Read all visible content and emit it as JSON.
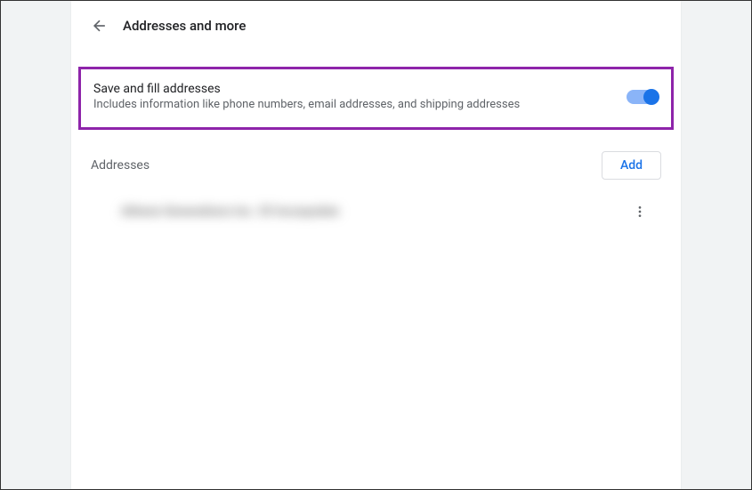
{
  "header": {
    "title": "Addresses and more"
  },
  "setting": {
    "title": "Save and fill addresses",
    "description": "Includes information like phone numbers, email addresses, and shipping addresses",
    "enabled": true
  },
  "addresses": {
    "section_title": "Addresses",
    "add_label": "Add",
    "items": [
      {
        "label": "Athene Generations Inc. 35 Incorpulate"
      }
    ]
  }
}
